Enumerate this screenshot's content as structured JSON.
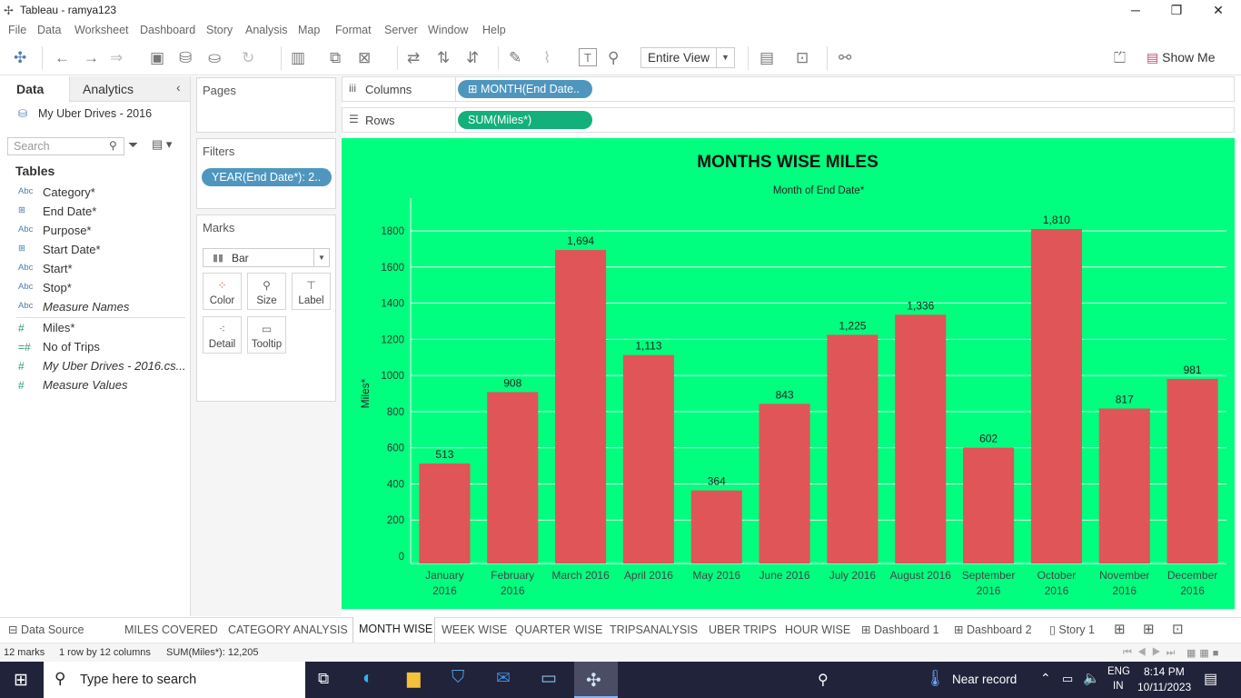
{
  "window": {
    "title": "Tableau - ramya123",
    "minimize": "─",
    "restore": "❐",
    "close": "✕"
  },
  "menu": [
    "File",
    "Data",
    "Worksheet",
    "Dashboard",
    "Story",
    "Analysis",
    "Map",
    "Format",
    "Server",
    "Window",
    "Help"
  ],
  "toolbar": {
    "view_mode": "Entire View",
    "show_me": "Show Me"
  },
  "data_pane": {
    "tab_data": "Data",
    "tab_analytics": "Analytics",
    "datasource": "My Uber Drives - 2016",
    "search_placeholder": "Search",
    "tables_heading": "Tables",
    "fields": [
      {
        "type": "Abc",
        "name": "Category*"
      },
      {
        "type": "⊞",
        "name": "End Date*"
      },
      {
        "type": "Abc",
        "name": "Purpose*"
      },
      {
        "type": "⊞",
        "name": "Start Date*"
      },
      {
        "type": "Abc",
        "name": "Start*"
      },
      {
        "type": "Abc",
        "name": "Stop*"
      },
      {
        "type": "Abc",
        "name": "Measure Names"
      },
      {
        "type": "#",
        "name": "Miles*"
      },
      {
        "type": "=#",
        "name": "No of Trips"
      },
      {
        "type": "#",
        "name": "My Uber Drives - 2016.cs..."
      },
      {
        "type": "#",
        "name": "Measure Values"
      }
    ]
  },
  "pages": {
    "title": "Pages"
  },
  "filters": {
    "title": "Filters",
    "pill": "YEAR(End Date*): 2.."
  },
  "marks": {
    "title": "Marks",
    "type": "Bar",
    "buttons": [
      "Color",
      "Size",
      "Label",
      "Detail",
      "Tooltip"
    ]
  },
  "shelves": {
    "columns_label": "Columns",
    "columns_pill": "⊞ MONTH(End Date..",
    "rows_label": "Rows",
    "rows_pill": "SUM(Miles*)"
  },
  "chart_data": {
    "type": "bar",
    "title": "MONTHS WISE MILES",
    "subtitle": "Month of End Date*",
    "ylabel": "Miles*",
    "ylim": [
      0,
      1800
    ],
    "yticks": [
      0,
      200,
      400,
      600,
      800,
      1000,
      1200,
      1400,
      1600,
      1800
    ],
    "categories": [
      [
        "January",
        "2016"
      ],
      [
        "February",
        "2016"
      ],
      [
        "March 2016",
        ""
      ],
      [
        "April 2016",
        ""
      ],
      [
        "May 2016",
        ""
      ],
      [
        "June 2016",
        ""
      ],
      [
        "July 2016",
        ""
      ],
      [
        "August 2016",
        ""
      ],
      [
        "September",
        "2016"
      ],
      [
        "October",
        "2016"
      ],
      [
        "November",
        "2016"
      ],
      [
        "December",
        "2016"
      ]
    ],
    "values": [
      513,
      908,
      1694,
      1113,
      364,
      843,
      1225,
      1336,
      602,
      1810,
      817,
      981
    ],
    "value_labels": [
      "513",
      "908",
      "1,694",
      "1,113",
      "364",
      "843",
      "1,225",
      "1,336",
      "602",
      "1,810",
      "817",
      "981"
    ],
    "bar_color": "#e05557",
    "background": "#00ff7f",
    "grid": true
  },
  "sheet_tabs": [
    {
      "label": "Data Source",
      "icon": "⊟"
    },
    {
      "label": "MILES COVERED",
      "icon": ""
    },
    {
      "label": "CATEGORY ANALYSIS",
      "icon": ""
    },
    {
      "label": "MONTH WISE",
      "icon": "",
      "active": true
    },
    {
      "label": "WEEK WISE",
      "icon": ""
    },
    {
      "label": "QUARTER WISE",
      "icon": ""
    },
    {
      "label": "TRIPSANALYSIS",
      "icon": ""
    },
    {
      "label": "UBER TRIPS",
      "icon": ""
    },
    {
      "label": "HOUR WISE",
      "icon": ""
    },
    {
      "label": "Dashboard 1",
      "icon": "⊞"
    },
    {
      "label": "Dashboard 2",
      "icon": "⊞"
    },
    {
      "label": "Story 1",
      "icon": "▯"
    }
  ],
  "status": {
    "marks": "12 marks",
    "layout": "1 row by 12 columns",
    "sum": "SUM(Miles*): 12,205"
  },
  "taskbar": {
    "search_placeholder": "Type here to search",
    "weather": "Near record",
    "lang1": "ENG",
    "lang2": "IN",
    "time": "8:14 PM",
    "date": "10/11/2023"
  }
}
